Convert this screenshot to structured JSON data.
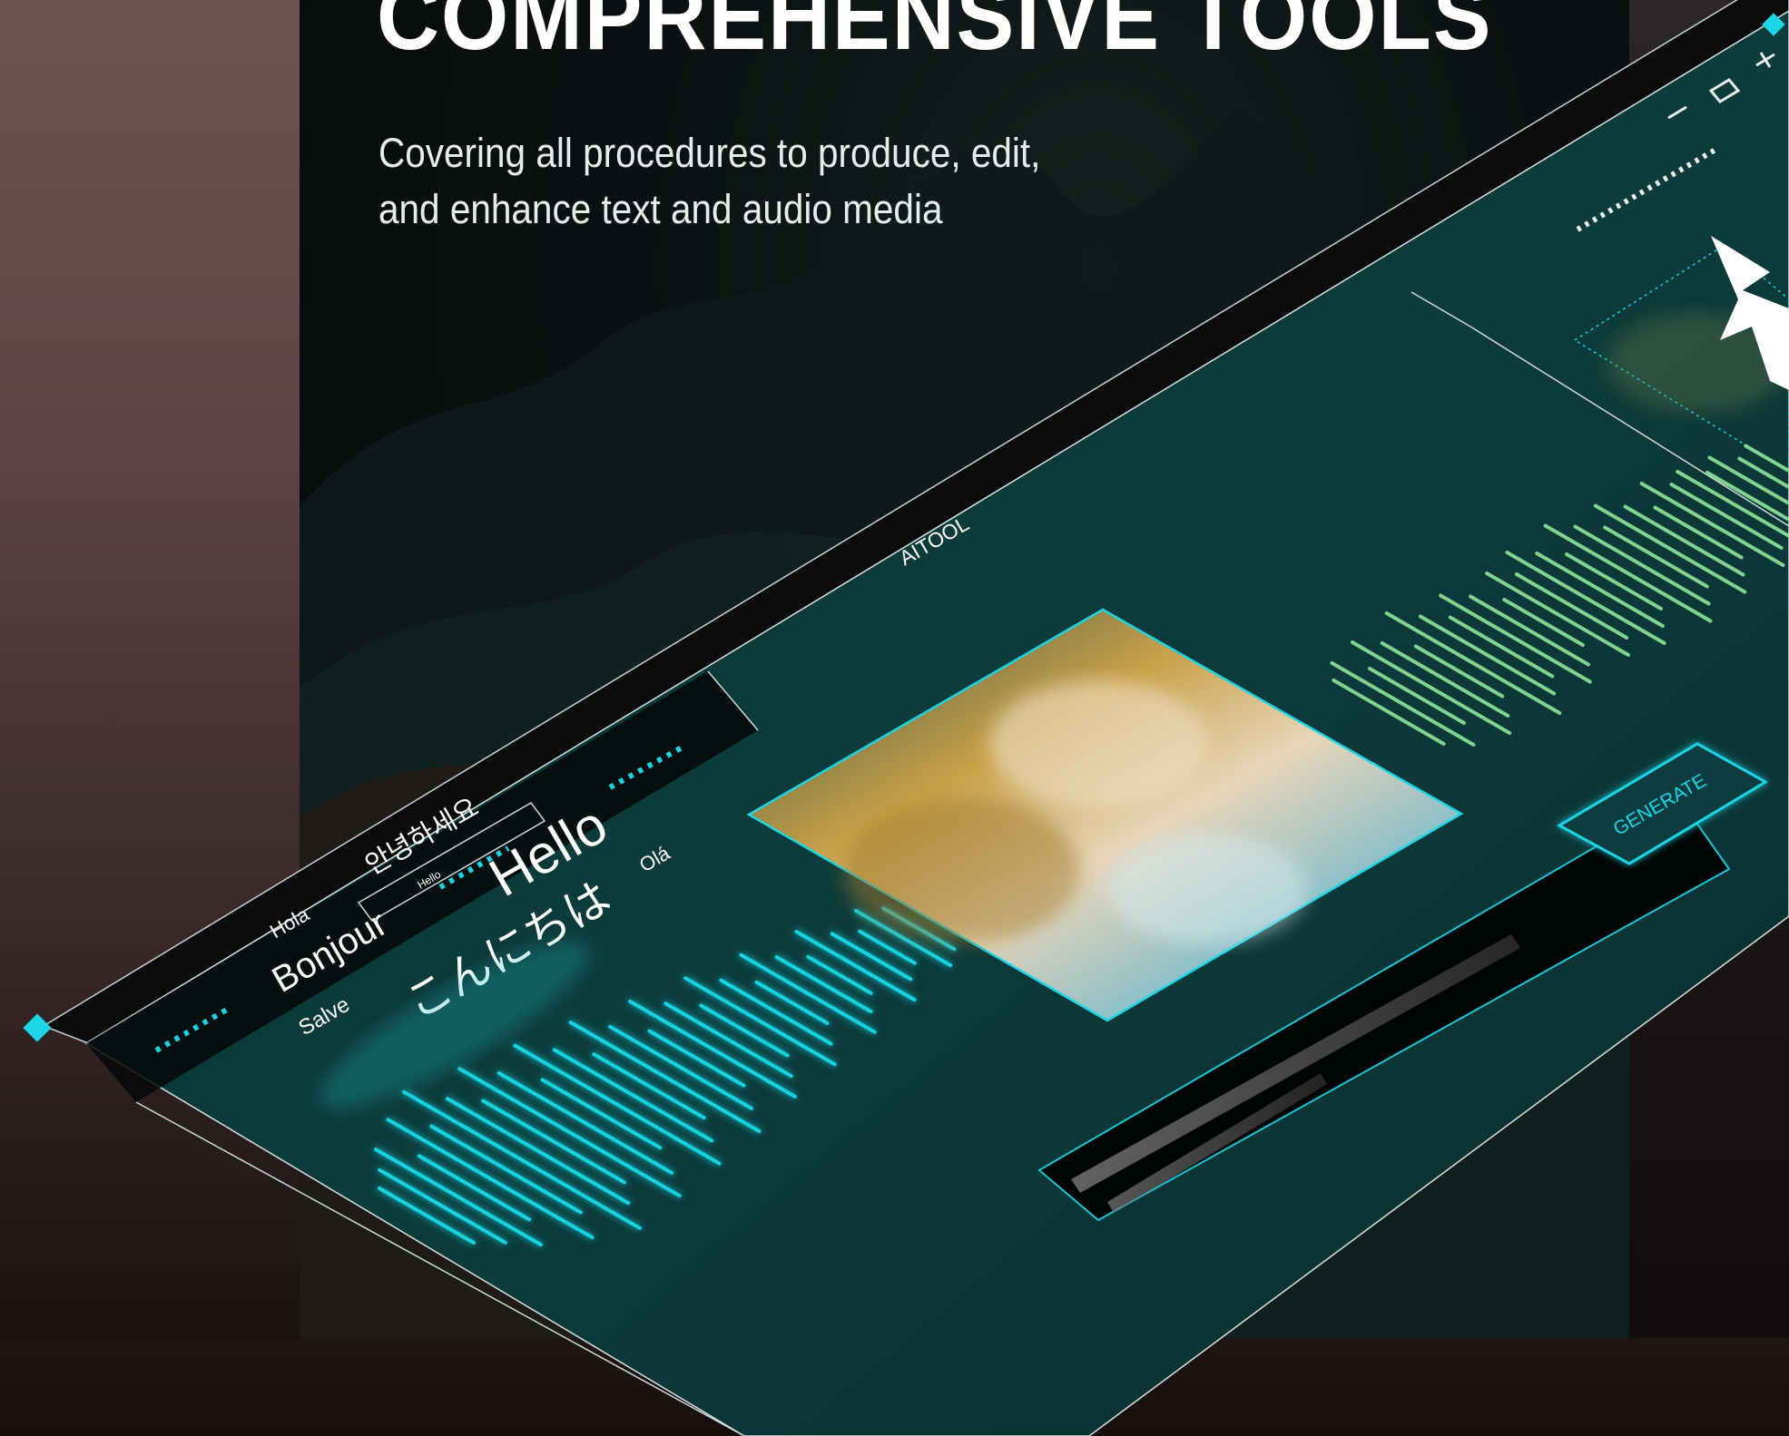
{
  "heading": {
    "title": "COMPREHENSIVE TOOLS",
    "subtitle_line1": "Covering all procedures to produce, edit,",
    "subtitle_line2": "and enhance text and audio media"
  },
  "app_window": {
    "title": "AITOOL",
    "controls": [
      "minimize",
      "maximize",
      "close"
    ],
    "generate_button": "GENERATE"
  },
  "languages": {
    "hola": "Hola",
    "korean": "안녕하세요",
    "hello_small": "Hello",
    "hello": "Hello",
    "ola": "Olá",
    "bonjour": "Bonjour",
    "japanese": "こんにちは",
    "salve": "Salve"
  },
  "icons": [
    "minimize-icon",
    "maximize-icon",
    "close-icon",
    "logo-icon",
    "illustration-image"
  ],
  "colors": {
    "accent_cyan": "#19d3e0",
    "accent_green": "#7fe08a",
    "panel_teal": "#0c3a3a"
  }
}
